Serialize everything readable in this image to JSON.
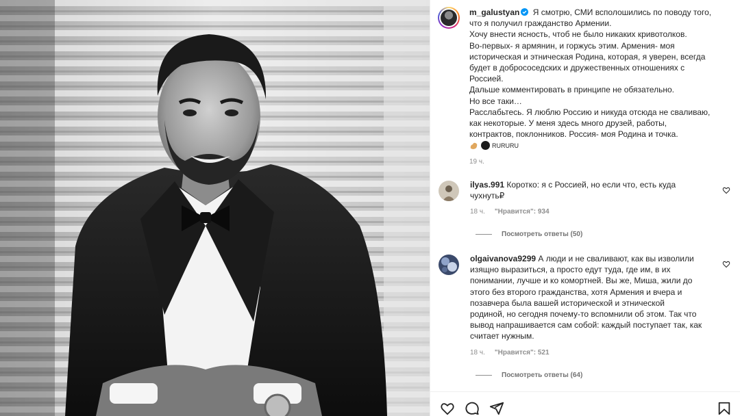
{
  "post": {
    "username": "m_galustyan",
    "caption_lines": [
      "Я смотрю, СМИ всполошились по поводу того,",
      "что я получил гражданство Армении.",
      "Хочу внести ясность, чтоб не было никаких кривотолков.",
      "Во-первых- я армянин, и горжусь этим. Армения- моя",
      "историческая и этническая Родина, которая, я уверен, всегда",
      "будет в добрососедских и дружественных отношениях с",
      "Россией.",
      "Дальше комментировать в принципе не обязательно.",
      "Но все таки…",
      "Расслабьтесь. Я люблю Россию и никуда отсюда не сваливаю,",
      "как некоторые. У меня здесь много друзей, работы,",
      "контрактов, поклонников. Россия- моя Родина и точка."
    ],
    "source_tag": "RURURU",
    "time": "19 ч."
  },
  "comments": [
    {
      "username": "ilyas.991",
      "text_first": "Коротко: я с Россией, но если что, есть куда",
      "text_rest": [
        "чухнуть₽"
      ],
      "time": "18 ч.",
      "likes": "\"Нравится\": 934",
      "replies": "Посмотреть ответы (50)"
    },
    {
      "username": "olgaivanova9299",
      "text_first": "А люди и не сваливают, как вы изволили",
      "text_rest": [
        "изящно выразиться, а просто едут туда, где им, в их",
        "понимании, лучше и ко комортней. Вы же, Миша, жили до",
        "этого без второго гражданства, хотя Армения и вчера и",
        "позавчера была вашей исторической и этнической",
        "родиной, но сегодня почему-то вспомнили об этом. Так что",
        "вывод напрашивается сам собой: каждый поступает так, как",
        "считает нужным."
      ],
      "time": "18 ч.",
      "likes": "\"Нравится\": 521",
      "replies": "Посмотреть ответы (64)"
    }
  ],
  "icons": {
    "verified": "verified-badge-icon",
    "like": "heart-icon",
    "comment": "comment-icon",
    "share": "share-icon",
    "save": "bookmark-icon"
  },
  "colors": {
    "verified": "#0095f6",
    "text": "#262626",
    "muted": "#8e8e8e"
  }
}
